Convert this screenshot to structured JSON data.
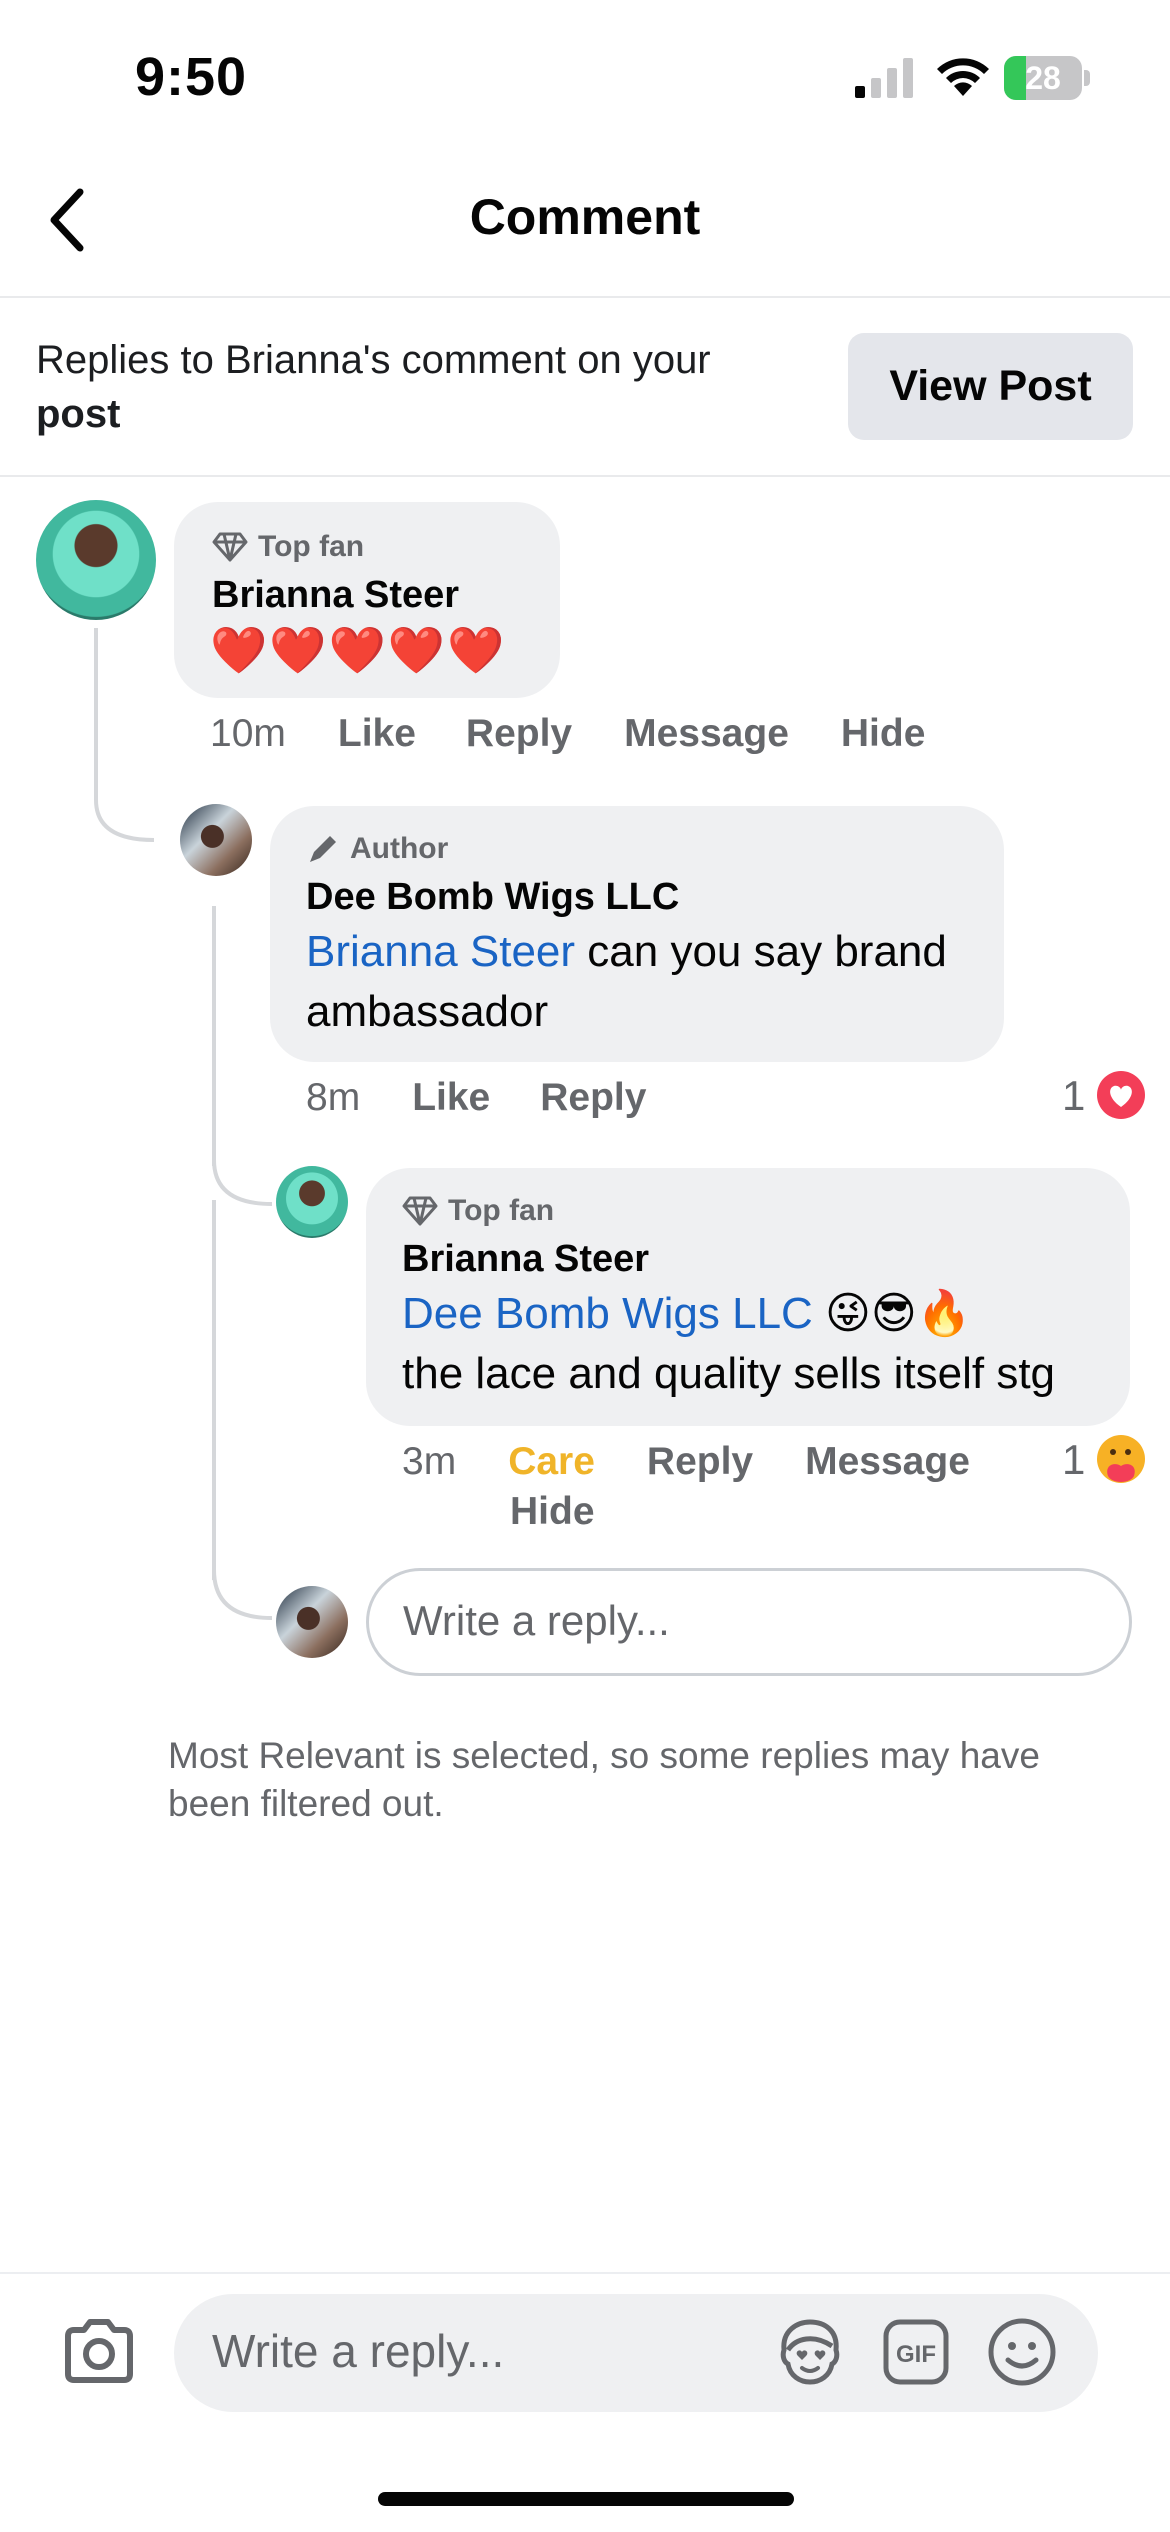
{
  "status_bar": {
    "time": "9:50",
    "battery": "28",
    "battery_level": 0.28,
    "icons": [
      "signal-icon",
      "wifi-icon",
      "battery-icon"
    ]
  },
  "header": {
    "title": "Comment",
    "back_icon": "chevron-left-icon"
  },
  "context": {
    "text": "Replies to Brianna's comment on your",
    "bold": "post",
    "view_post_label": "View Post"
  },
  "comments": [
    {
      "badge": "Top fan",
      "badge_icon": "diamond-icon",
      "author": "Brianna Steer",
      "body": "❤️❤️❤️❤️❤️",
      "time": "10m",
      "actions": [
        "Like",
        "Reply",
        "Message",
        "Hide"
      ]
    },
    {
      "badge": "Author",
      "badge_icon": "pencil-icon",
      "author": "Dee Bomb Wigs LLC",
      "mention": "Brianna Steer",
      "body": " can you say brand ambassador",
      "time": "8m",
      "actions": [
        "Like",
        "Reply"
      ],
      "reaction_count": "1",
      "reaction_icon": "love-reaction-icon"
    },
    {
      "badge": "Top fan",
      "badge_icon": "diamond-icon",
      "author": "Brianna Steer",
      "mention": "Dee Bomb Wigs LLC",
      "body_emojis": " 😜😎🔥",
      "body_line2": "the lace and quality sells itself stg",
      "time": "3m",
      "actions": [
        "Care",
        "Reply",
        "Message",
        "Hide"
      ],
      "reaction_count": "1",
      "reaction_icon": "care-reaction-icon"
    }
  ],
  "reply_box": {
    "placeholder": "Write a reply..."
  },
  "note": "Most Relevant is selected, so some replies may have been filtered out.",
  "composer": {
    "placeholder": "Write a reply...",
    "icons": [
      "camera-icon",
      "avatar-sticker-icon",
      "gif-icon",
      "emoji-icon"
    ]
  },
  "colors": {
    "mention": "#1a64c4",
    "care": "#f0b429",
    "bubble": "#eff0f2",
    "muted": "#65676b"
  }
}
